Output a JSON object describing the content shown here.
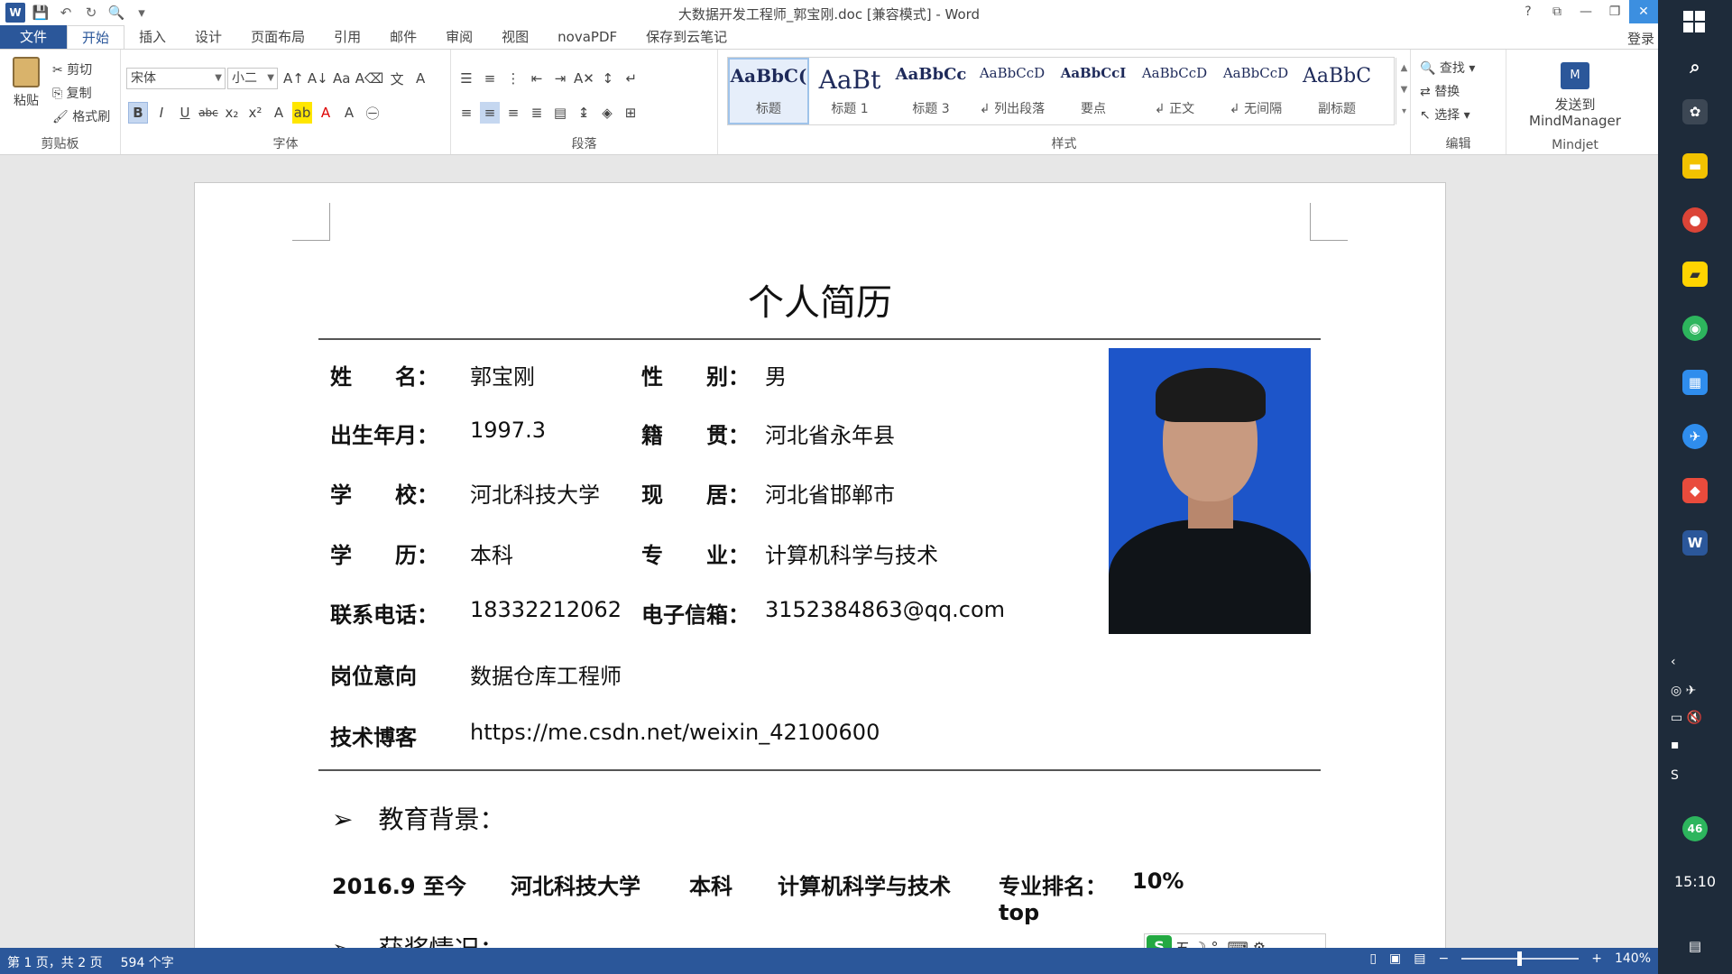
{
  "window": {
    "title": "大数据开发工程师_郭宝刚.doc [兼容模式] - Word",
    "login": "登录"
  },
  "qat": {
    "word_logo": "W",
    "save": "💾",
    "undo": "↶",
    "redo": "↻",
    "preview": "🔍",
    "more": "▾"
  },
  "winctl": {
    "help": "?",
    "ribbon_opts": "⧉",
    "min": "—",
    "restore": "❐",
    "close": "✕"
  },
  "tabs": [
    "文件",
    "开始",
    "插入",
    "设计",
    "页面布局",
    "引用",
    "邮件",
    "审阅",
    "视图",
    "novaPDF",
    "保存到云笔记"
  ],
  "active_tab": "开始",
  "clipboard": {
    "paste": "粘贴",
    "cut": "剪切",
    "copy": "复制",
    "format_painter": "格式刷",
    "label": "剪贴板"
  },
  "font": {
    "name": "宋体",
    "size": "小二",
    "label": "字体"
  },
  "paragraph": {
    "label": "段落"
  },
  "styles": {
    "label": "样式",
    "items": [
      {
        "preview": "AaBbC(",
        "name": "标题"
      },
      {
        "preview": "AaBt",
        "name": "标题 1"
      },
      {
        "preview": "AaBbCc",
        "name": "标题 3"
      },
      {
        "preview": "AaBbCcD",
        "name": "↲ 列出段落"
      },
      {
        "preview": "AaBbCcI",
        "name": "要点"
      },
      {
        "preview": "AaBbCcD",
        "name": "↲ 正文"
      },
      {
        "preview": "AaBbCcD",
        "name": "↲ 无间隔"
      },
      {
        "preview": "AaBbC",
        "name": "副标题"
      }
    ]
  },
  "editing": {
    "find": "查找",
    "replace": "替换",
    "select": "选择",
    "label": "编辑"
  },
  "mindjet": {
    "btn1": "发送到",
    "btn2": "MindManager",
    "label": "Mindjet"
  },
  "doc": {
    "title": "个人简历",
    "fields": [
      {
        "label": "姓　　名：",
        "value": "郭宝刚"
      },
      {
        "label": "性　　别：",
        "value": "男"
      },
      {
        "label": "出生年月：",
        "value": "1997.3"
      },
      {
        "label": "籍　　贯：",
        "value": "河北省永年县"
      },
      {
        "label": "学　　校：",
        "value": "河北科技大学"
      },
      {
        "label": "现　　居：",
        "value": "河北省邯郸市"
      },
      {
        "label": "学　　历：",
        "value": "本科"
      },
      {
        "label": "专　　业：",
        "value": "计算机科学与技术"
      },
      {
        "label": "联系电话：",
        "value": "18332212062"
      },
      {
        "label": "电子信箱：",
        "value": "3152384863@qq.com"
      },
      {
        "label": "岗位意向",
        "value": "数据仓库工程师"
      },
      {
        "label": "技术博客",
        "value": "https://me.csdn.net/weixin_42100600"
      }
    ],
    "section_edu": "➢　教育背景：",
    "edu": [
      "2016.9 至今",
      "河北科技大学",
      "本科",
      "计算机科学与技术",
      "专业排名：top",
      "10%"
    ],
    "section_award": "➢　获奖情况："
  },
  "ime": {
    "s": "S",
    "mode": "五",
    "icons": "☽ °, ⌨ ⚙"
  },
  "status": {
    "page": "第 1 页，共 2 页",
    "words": "594 个字",
    "zoom": "140%"
  },
  "taskbar": {
    "clock": "15:10",
    "badge": "46"
  }
}
